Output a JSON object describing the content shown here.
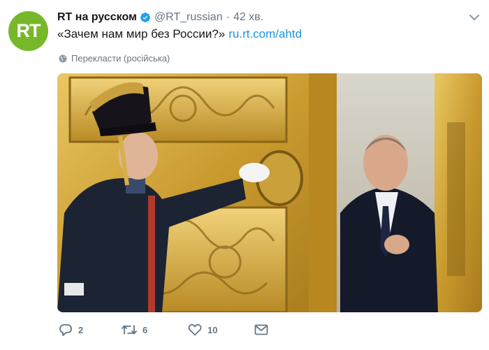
{
  "tweet": {
    "author_name": "RT на русском",
    "handle": "@RT_russian",
    "separator": "·",
    "time": "42 хв.",
    "avatar_text": "RT",
    "text": "«Зачем нам мир без России?»",
    "link": "ru.rt.com/ahtd",
    "translate_label": "Перекласти (російська)"
  },
  "actions": {
    "reply_count": "2",
    "retweet_count": "6",
    "like_count": "10"
  },
  "icons": {
    "verified": "verified-badge-icon",
    "caret": "chevron-down-icon",
    "globe": "globe-icon",
    "reply": "reply-icon",
    "retweet": "retweet-icon",
    "like": "heart-icon",
    "dm": "envelope-icon"
  },
  "colors": {
    "accent": "#1b95e0",
    "muted": "#657786",
    "avatar_bg": "#77b82a"
  }
}
